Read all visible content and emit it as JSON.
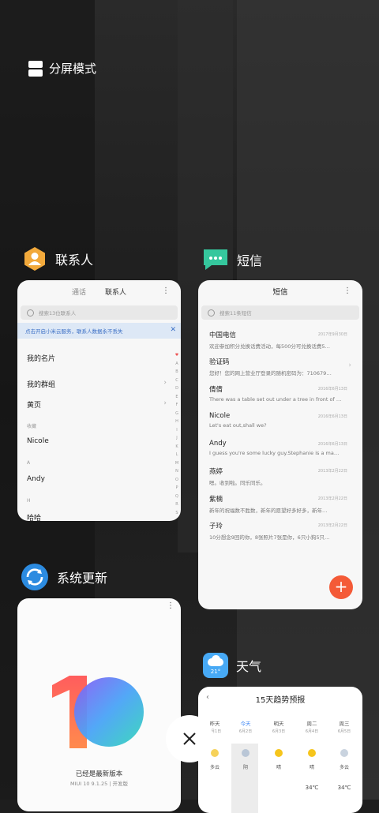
{
  "split_screen": {
    "label": "分屏模式"
  },
  "apps": {
    "contacts": {
      "label": "联系人",
      "tabs": [
        "通话",
        "联系人"
      ],
      "search_placeholder": "搜索13位联系人",
      "banner": "点击开启小米云服务，联系人数据永不丢失",
      "rows": [
        "我的名片",
        "我的群组",
        "黄页"
      ],
      "section_fav": "收藏",
      "fav_contact": "Nicole",
      "letter_a": "A",
      "contact_a": "Andy",
      "letter_h": "H",
      "contact_h": "哈哈",
      "index": [
        "A",
        "B",
        "C",
        "D",
        "E",
        "F",
        "G",
        "H",
        "I",
        "J",
        "K",
        "L",
        "M",
        "N",
        "O",
        "P",
        "Q",
        "R",
        "S"
      ]
    },
    "messages": {
      "label": "短信",
      "title": "短信",
      "search_placeholder": "搜索11条短信",
      "threads": [
        {
          "name": "中国电信",
          "date": "2017年9月30日",
          "preview": "欢迎参加积分兑换话费活动，每500分可兑换话费5…"
        },
        {
          "name": "验证码",
          "date": "",
          "preview": "您好！您的网上营业厅登录的随机密码为：710679…"
        },
        {
          "name": "倩倩",
          "date": "2016年6月13日",
          "preview": "There was a table set out under a tree in front of …"
        },
        {
          "name": "Nicole",
          "date": "2016年6月13日",
          "preview": "Let's eat out,shall we?"
        },
        {
          "name": "Andy",
          "date": "2016年6月13日",
          "preview": "I guess you're some lucky guy.Stephanie is a ma…"
        },
        {
          "name": "燕婷",
          "date": "2013年2月22日",
          "preview": "嗯。收到啦。同乐同乐。"
        },
        {
          "name": "紫楠",
          "date": "2013年2月22日",
          "preview": "新年的祝福数不胜数，新年的愿望好多好多，新年…"
        },
        {
          "name": "子玲",
          "date": "2013年2月22日",
          "preview": "10分想念9回的你，8张照片7张是你，6只小狗5只…"
        }
      ],
      "fab": "+"
    },
    "update": {
      "label": "系统更新",
      "status": "已经是最新版本",
      "version": "MIUI 10 9.1.25 | 开发版"
    },
    "weather": {
      "label": "天气",
      "icon_temp": "21°",
      "title": "15天趋势预报",
      "days": [
        {
          "name": "昨天",
          "date": "6月1日",
          "cond": "多云",
          "temp": ""
        },
        {
          "name": "今天",
          "date": "6月2日",
          "cond": "阴",
          "temp": ""
        },
        {
          "name": "明天",
          "date": "6月3日",
          "cond": "晴",
          "temp": ""
        },
        {
          "name": "周二",
          "date": "6月4日",
          "cond": "晴",
          "temp": "34℃"
        },
        {
          "name": "周三",
          "date": "6月5日",
          "cond": "多云",
          "temp": "34℃"
        }
      ]
    }
  },
  "colors": {
    "accent_red": "#f45a37",
    "contacts_icon": "#f2a93b",
    "messages_icon": "#35c79d",
    "update_icon": "#2c8be0",
    "weather_icon": "#47a9f5",
    "today_blue": "#3f87f5"
  }
}
